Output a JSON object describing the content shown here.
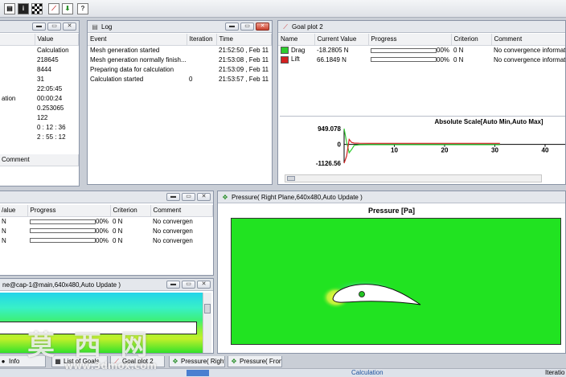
{
  "summary": {
    "headers": [
      "Value"
    ],
    "rows": [
      {
        "label": "",
        "value": "Calculation"
      },
      {
        "label": "",
        "value": "218645"
      },
      {
        "label": "",
        "value": "8444"
      },
      {
        "label": "",
        "value": "31"
      },
      {
        "label": "",
        "value": "22:05:45"
      },
      {
        "label": "ation",
        "value": "00:00:24"
      },
      {
        "label": "",
        "value": "0.253065"
      },
      {
        "label": "",
        "value": "122"
      },
      {
        "label": "",
        "value": "0 : 12 : 36"
      },
      {
        "label": "",
        "value": "2 : 55 : 12"
      }
    ],
    "comment_header": "Comment"
  },
  "log": {
    "title": "Log",
    "headers": [
      "Event",
      "Iteration",
      "Time"
    ],
    "rows": [
      {
        "event": "Mesh generation started",
        "iteration": "",
        "time": "21:52:50 , Feb 11"
      },
      {
        "event": "Mesh generation normally finish...",
        "iteration": "",
        "time": "21:53:08 , Feb 11"
      },
      {
        "event": "Preparing data for calculation",
        "iteration": "",
        "time": "21:53:09 , Feb 11"
      },
      {
        "event": "Calculation started",
        "iteration": "0",
        "time": "21:53:57 , Feb 11"
      }
    ]
  },
  "goal_plot": {
    "title": "Goal plot 2",
    "headers": [
      "Name",
      "Current Value",
      "Progress",
      "Criterion",
      "Comment"
    ],
    "rows": [
      {
        "name": "Drag",
        "value": "-18.2805 N",
        "progress_pct": "00%",
        "criterion": "0 N",
        "comment": "No convergence informati",
        "color": "#2ecc2e"
      },
      {
        "name": "Lift",
        "value": "66.1849 N",
        "progress_pct": "00%",
        "criterion": "0 N",
        "comment": "No convergence informati",
        "color": "#d42020"
      }
    ]
  },
  "chart_data": {
    "type": "line",
    "title": "Absolute Scale[Auto Min,Auto Max]",
    "xlabel": "",
    "ylabel": "",
    "y_ticks": [
      "949.078",
      "0",
      "-1126.56"
    ],
    "x_ticks": [
      "10",
      "20",
      "30",
      "40"
    ],
    "ylim": [
      -1126.56,
      949.078
    ],
    "xlim": [
      0,
      44
    ],
    "series": [
      {
        "color": "#2ecc2e",
        "x": [
          0,
          0.5,
          1,
          1.5,
          2,
          3,
          5,
          10,
          20,
          31
        ],
        "y": [
          949.078,
          150,
          -500,
          -300,
          -60,
          -20,
          -18,
          -18,
          -18,
          -18
        ]
      },
      {
        "color": "#d42020",
        "x": [
          0,
          0.5,
          1,
          1.5,
          2,
          3,
          5,
          10,
          20,
          31
        ],
        "y": [
          -1126.56,
          -700,
          300,
          120,
          80,
          70,
          66,
          66,
          66,
          66
        ]
      }
    ]
  },
  "goals_table": {
    "headers": [
      "/alue",
      "Progress",
      "Criterion",
      "Comment"
    ],
    "rows": [
      {
        "value": "N",
        "progress_pct": "00%",
        "criterion": "0 N",
        "comment": "No convergen"
      },
      {
        "value": "N",
        "progress_pct": "00%",
        "criterion": "0 N",
        "comment": "No convergen"
      },
      {
        "value": "N",
        "progress_pct": "00%",
        "criterion": "0 N",
        "comment": "No convergen"
      }
    ]
  },
  "cutplot_left": {
    "title": "ne@cap-1@main,640x480,Auto Update )"
  },
  "pressure": {
    "title": "Pressure( Right Plane,640x480,Auto Update )",
    "plot_title": "Pressure [Pa]"
  },
  "tabs": [
    {
      "label": "Info",
      "icon": "info-icon"
    },
    {
      "label": "List of Goals",
      "icon": "list-icon"
    },
    {
      "label": "Goal plot 2",
      "icon": "goal-plot-icon"
    },
    {
      "label": "Pressure( Right F",
      "icon": "pressure-plot-icon"
    },
    {
      "label": "Pressure( Front F",
      "icon": "pressure-plot-icon"
    }
  ],
  "status": {
    "calculation": "Calculation",
    "iteration": "Iteratio"
  },
  "watermark": {
    "chars": "莫 西 网",
    "url": "www.3dmox.com"
  },
  "colors": {
    "field_green": "#21e321",
    "window_chrome": "#e4e7ec",
    "progress_blue": "#4a7fd0"
  }
}
